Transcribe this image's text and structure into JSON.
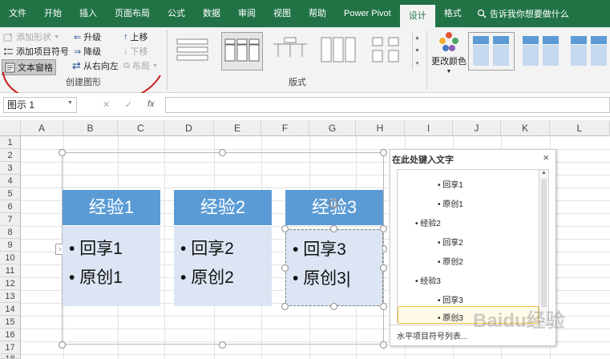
{
  "tabs": [
    "文件",
    "开始",
    "插入",
    "页面布局",
    "公式",
    "数据",
    "审阅",
    "视图",
    "帮助",
    "Power Pivot",
    "设计",
    "格式"
  ],
  "active_tab": "设计",
  "tell_me": "告诉我你想要做什么",
  "ribbon": {
    "create_graphic": {
      "add_shape": "添加形状",
      "add_bullet": "添加项目符号",
      "text_pane": "文本窗格",
      "promote": "升级",
      "demote": "降级",
      "right_to_left": "从右向左",
      "move_up": "上移",
      "move_down": "下移",
      "layout": "布局",
      "label": "创建图形"
    },
    "layouts_label": "版式",
    "change_colors": "更改颜色"
  },
  "name_box": "图示 1",
  "fx": "fx",
  "columns": [
    "A",
    "B",
    "C",
    "D",
    "E",
    "F",
    "G",
    "H",
    "I",
    "J",
    "K",
    "L"
  ],
  "rows": [
    "1",
    "2",
    "3",
    "4",
    "5",
    "6",
    "7",
    "8",
    "9",
    "10",
    "11",
    "12",
    "13",
    "14",
    "15",
    "16",
    "17",
    "18"
  ],
  "smartart": [
    {
      "title": "经验1",
      "items": [
        "回享1",
        "原创1"
      ]
    },
    {
      "title": "经验2",
      "items": [
        "回享2",
        "原创2"
      ]
    },
    {
      "title": "经验3",
      "items": [
        "回享3",
        "原创3"
      ]
    }
  ],
  "text_pane": {
    "title": "在此处键入文字",
    "close": "×",
    "items": [
      {
        "level": 2,
        "text": "回享1"
      },
      {
        "level": 2,
        "text": "原创1"
      },
      {
        "level": 1,
        "text": "经验2"
      },
      {
        "level": 2,
        "text": "回享2"
      },
      {
        "level": 2,
        "text": "原创2"
      },
      {
        "level": 1,
        "text": "经验3"
      },
      {
        "level": 2,
        "text": "回享3"
      },
      {
        "level": 2,
        "text": "原创3"
      }
    ],
    "footer": "水平项目符号列表..."
  },
  "watermark": "Baidu经验",
  "colors": {
    "excel_green": "#217346",
    "smartart_blue": "#5b9bd5",
    "smartart_light": "#dbe5f3",
    "annotation_red": "#cc1f1f"
  }
}
